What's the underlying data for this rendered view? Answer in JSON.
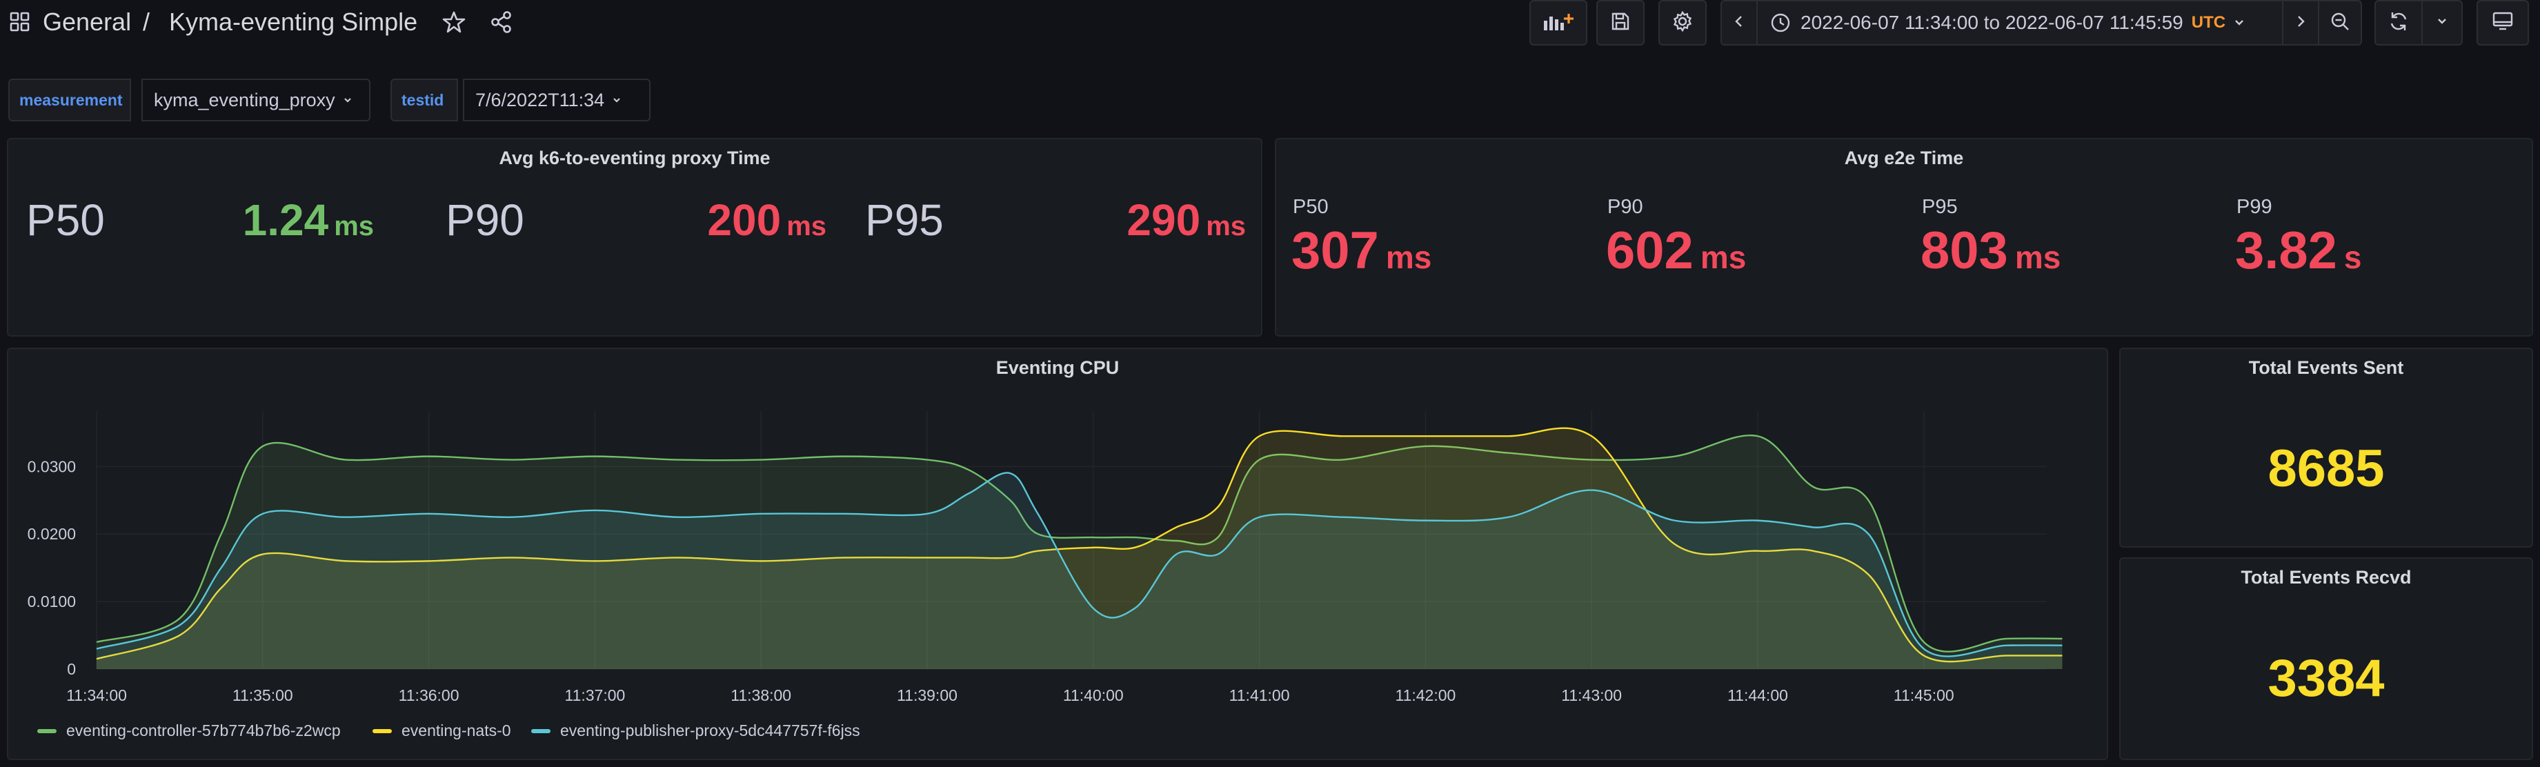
{
  "header": {
    "breadcrumb_folder": "General",
    "breadcrumb_separator": "/",
    "dashboard_title": "Kyma-eventing Simple",
    "time_range": "2022-06-07 11:34:00 to 2022-06-07 11:45:59",
    "timezone": "UTC",
    "icons": [
      "apps-icon",
      "star-icon",
      "share-icon",
      "add-panel-icon",
      "save-icon",
      "settings-icon",
      "chevron-left-icon",
      "clock-icon",
      "chevron-down-icon",
      "chevron-right-icon",
      "zoom-out-icon",
      "refresh-icon",
      "tv-icon"
    ]
  },
  "variables": {
    "measurement": {
      "label": "measurement",
      "value": "kyma_eventing_proxy"
    },
    "testid": {
      "label": "testid",
      "value": "7/6/2022T11:34"
    }
  },
  "panels": {
    "proxy_time": {
      "title": "Avg k6-to-eventing proxy Time",
      "stats": [
        {
          "label": "P50",
          "value": "1.24",
          "unit": "ms",
          "color": "#73bf69"
        },
        {
          "label": "P90",
          "value": "200",
          "unit": "ms",
          "color": "#f2495c"
        },
        {
          "label": "P95",
          "value": "290",
          "unit": "ms",
          "color": "#f2495c"
        }
      ]
    },
    "e2e_time": {
      "title": "Avg e2e Time",
      "stats": [
        {
          "label": "P50",
          "value": "307",
          "unit": "ms",
          "color": "#f2495c"
        },
        {
          "label": "P90",
          "value": "602",
          "unit": "ms",
          "color": "#f2495c"
        },
        {
          "label": "P95",
          "value": "803",
          "unit": "ms",
          "color": "#f2495c"
        },
        {
          "label": "P99",
          "value": "3.82",
          "unit": "s",
          "color": "#f2495c"
        }
      ]
    },
    "cpu": {
      "title": "Eventing CPU"
    },
    "events_sent": {
      "title": "Total Events Sent",
      "value": "8685",
      "color": "#fade2a"
    },
    "events_recvd": {
      "title": "Total Events Recvd",
      "value": "3384",
      "color": "#fade2a"
    }
  },
  "chart_data": {
    "type": "area",
    "title": "Eventing CPU",
    "x": [
      "11:34:00",
      "11:34:30",
      "11:34:45",
      "11:35:00",
      "11:35:30",
      "11:36:00",
      "11:36:30",
      "11:37:00",
      "11:37:30",
      "11:38:00",
      "11:38:30",
      "11:39:00",
      "11:39:15",
      "11:39:30",
      "11:39:40",
      "11:40:00",
      "11:40:15",
      "11:40:30",
      "11:40:45",
      "11:41:00",
      "11:41:30",
      "11:42:00",
      "11:42:30",
      "11:43:00",
      "11:43:30",
      "11:44:00",
      "11:44:20",
      "11:44:40",
      "11:45:00",
      "11:45:30",
      "11:45:50"
    ],
    "xticks": [
      "11:34:00",
      "11:35:00",
      "11:36:00",
      "11:37:00",
      "11:38:00",
      "11:39:00",
      "11:40:00",
      "11:41:00",
      "11:42:00",
      "11:43:00",
      "11:44:00",
      "11:45:00"
    ],
    "yticks": [
      "0",
      "0.0100",
      "0.0200",
      "0.0300"
    ],
    "ylim": [
      0,
      0.038
    ],
    "grid": true,
    "legend_placement": "bottom-left",
    "series": [
      {
        "name": "eventing-controller-57b774b7b6-z2wcp",
        "color": "#73bf69",
        "values": [
          0.004,
          0.0075,
          0.02,
          0.033,
          0.031,
          0.0315,
          0.031,
          0.0315,
          0.031,
          0.031,
          0.0315,
          0.031,
          0.0295,
          0.025,
          0.02,
          0.0195,
          0.0195,
          0.019,
          0.0195,
          0.031,
          0.031,
          0.033,
          0.032,
          0.031,
          0.0315,
          0.0345,
          0.027,
          0.025,
          0.004,
          0.0045,
          0.0045
        ]
      },
      {
        "name": "eventing-nats-0",
        "color": "#fade2a",
        "values": [
          0.0015,
          0.005,
          0.012,
          0.017,
          0.016,
          0.016,
          0.0165,
          0.016,
          0.0165,
          0.016,
          0.0165,
          0.0165,
          0.0165,
          0.0165,
          0.0175,
          0.018,
          0.018,
          0.021,
          0.024,
          0.0345,
          0.0345,
          0.0345,
          0.0345,
          0.0345,
          0.0185,
          0.0175,
          0.0175,
          0.014,
          0.002,
          0.002,
          0.002
        ]
      },
      {
        "name": "eventing-publisher-proxy-5dc447757f-f6jss",
        "color": "#5ac7d8",
        "values": [
          0.003,
          0.0065,
          0.015,
          0.023,
          0.0225,
          0.023,
          0.0225,
          0.0235,
          0.0225,
          0.023,
          0.023,
          0.023,
          0.026,
          0.029,
          0.023,
          0.009,
          0.009,
          0.017,
          0.017,
          0.0225,
          0.0225,
          0.022,
          0.0225,
          0.0265,
          0.022,
          0.022,
          0.021,
          0.02,
          0.003,
          0.0035,
          0.0035
        ]
      }
    ]
  }
}
